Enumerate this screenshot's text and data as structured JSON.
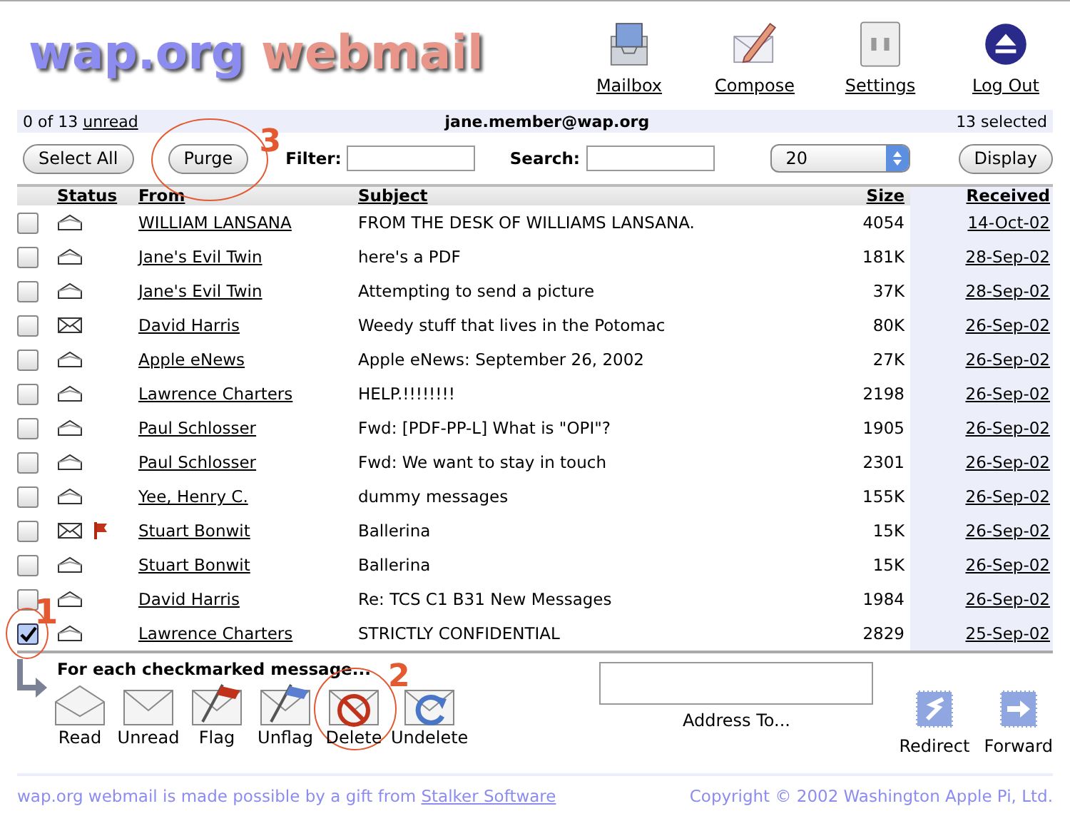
{
  "logo": {
    "part_1": "wap.org",
    "part_2": "webmail"
  },
  "nav": [
    {
      "label": "Mailbox",
      "kind": "mailbox"
    },
    {
      "label": "Compose",
      "kind": "compose"
    },
    {
      "label": "Settings",
      "kind": "settings"
    },
    {
      "label": "Log Out",
      "kind": "logout"
    }
  ],
  "info_bar": {
    "count": "0 of 13",
    "unread_link": "unread",
    "account": "jane.member@wap.org",
    "selected": "13 selected"
  },
  "toolbar": {
    "select_all": "Select All",
    "purge": "Purge",
    "purge_callout": "3",
    "filter_label": "Filter:",
    "search_label": "Search:",
    "page_size": "20",
    "display": "Display"
  },
  "table": {
    "columns": [
      {
        "label": "Status",
        "sorted": false
      },
      {
        "label": "From",
        "sorted": false
      },
      {
        "label": "Subject",
        "sorted": false
      },
      {
        "label": "Size",
        "sorted": false
      },
      {
        "label": "Received",
        "sorted": true
      }
    ],
    "rows": [
      {
        "checked": false,
        "unread": false,
        "flagged": false,
        "from": "WILLIAM LANSANA",
        "subject": "FROM THE DESK OF WILLIAMS LANSANA.",
        "size": "4054",
        "received": "14-Oct-02"
      },
      {
        "checked": false,
        "unread": false,
        "flagged": false,
        "from": "Jane's Evil Twin",
        "subject": "here's a PDF",
        "size": "181K",
        "received": "28-Sep-02"
      },
      {
        "checked": false,
        "unread": false,
        "flagged": false,
        "from": "Jane's Evil Twin",
        "subject": "Attempting to send a picture",
        "size": "37K",
        "received": "28-Sep-02"
      },
      {
        "checked": false,
        "unread": true,
        "flagged": false,
        "from": "David Harris",
        "subject": "Weedy stuff that lives in the Potomac",
        "size": "80K",
        "received": "26-Sep-02"
      },
      {
        "checked": false,
        "unread": false,
        "flagged": false,
        "from": "Apple eNews",
        "subject": "Apple eNews: September 26, 2002",
        "size": "27K",
        "received": "26-Sep-02"
      },
      {
        "checked": false,
        "unread": false,
        "flagged": false,
        "from": "Lawrence Charters",
        "subject": "HELP.!!!!!!!!",
        "size": "2198",
        "received": "26-Sep-02"
      },
      {
        "checked": false,
        "unread": false,
        "flagged": false,
        "from": "Paul Schlosser",
        "subject": "Fwd: [PDF-PP-L] What is \"OPI\"?",
        "size": "1905",
        "received": "26-Sep-02"
      },
      {
        "checked": false,
        "unread": false,
        "flagged": false,
        "from": "Paul Schlosser",
        "subject": "Fwd: We want to stay in touch",
        "size": "2301",
        "received": "26-Sep-02"
      },
      {
        "checked": false,
        "unread": false,
        "flagged": false,
        "from": "Yee, Henry C.",
        "subject": "dummy messages",
        "size": "155K",
        "received": "26-Sep-02"
      },
      {
        "checked": false,
        "unread": true,
        "flagged": true,
        "from": "Stuart Bonwit",
        "subject": "Ballerina",
        "size": "15K",
        "received": "26-Sep-02"
      },
      {
        "checked": false,
        "unread": false,
        "flagged": false,
        "from": "Stuart Bonwit",
        "subject": "Ballerina",
        "size": "15K",
        "received": "26-Sep-02"
      },
      {
        "checked": false,
        "unread": false,
        "flagged": false,
        "from": "David Harris",
        "subject": "Re: TCS C1 B31 New Messages",
        "size": "1984",
        "received": "26-Sep-02"
      },
      {
        "checked": true,
        "unread": false,
        "flagged": false,
        "from": "Lawrence Charters",
        "subject": "STRICTLY CONFIDENTIAL",
        "size": "2829",
        "received": "25-Sep-02",
        "callout": "1"
      }
    ]
  },
  "actions_heading": "For each checkmarked message...",
  "actions": [
    {
      "label": "Read",
      "kind": "read"
    },
    {
      "label": "Unread",
      "kind": "unread"
    },
    {
      "label": "Flag",
      "kind": "flag"
    },
    {
      "label": "Unflag",
      "kind": "unflag"
    },
    {
      "label": "Delete",
      "kind": "delete",
      "callout": "2"
    },
    {
      "label": "Undelete",
      "kind": "undelete"
    }
  ],
  "address_label": "Address To...",
  "send_actions": [
    {
      "label": "Redirect",
      "kind": "redirect"
    },
    {
      "label": "Forward",
      "kind": "forward"
    }
  ],
  "footer": {
    "text": "wap.org webmail is made possible by a gift from",
    "link": "Stalker Software",
    "copyright": "Copyright © 2002 Washington Apple Pi, Ltd."
  }
}
